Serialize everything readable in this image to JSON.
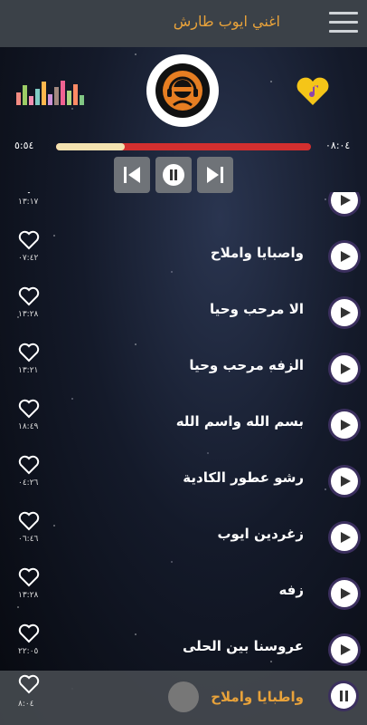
{
  "app": {
    "title": "اغني ايوب طارش"
  },
  "player": {
    "elapsed": "٥:٥٤",
    "total": "٠٨:٠٤",
    "progress": 0.27
  },
  "songs": [
    {
      "title": "",
      "duration": "١٣:١٧"
    },
    {
      "title": "واصبايا واملاح",
      "duration": "٠٧:٤٢"
    },
    {
      "title": "الا مرحب وحيا",
      "duration": "١٣:٢٨"
    },
    {
      "title": "الزفه مرحب وحيا",
      "duration": "١٣:٢١"
    },
    {
      "title": "بسم الله واسم الله",
      "duration": "١٨:٤٩"
    },
    {
      "title": "رشو عطور الكادية",
      "duration": "٠٤:٢٦"
    },
    {
      "title": "زغردين  ايوب",
      "duration": "٠٦:٤٦"
    },
    {
      "title": "زفه",
      "duration": "١٣:٢٨"
    },
    {
      "title": "عروسنا بين الحلى",
      "duration": "٢٢:٠٥"
    }
  ],
  "now_playing": {
    "title": "واطبايا واملاح",
    "duration": "٨:٠٤"
  }
}
